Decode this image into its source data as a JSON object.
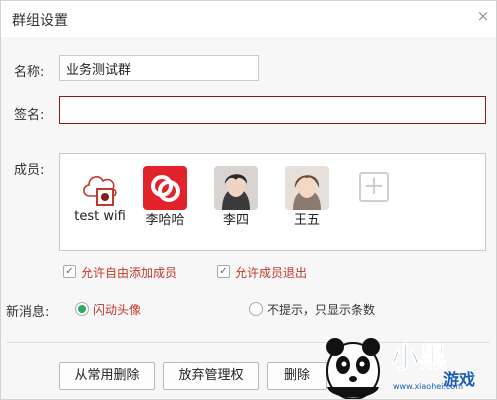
{
  "window": {
    "title": "群组设置",
    "close_label": "×"
  },
  "form": {
    "name_label": "名称:",
    "name_value": "业务测试群",
    "signature_label": "签名:",
    "signature_value": "",
    "members_label": "成员:",
    "new_message_label": "新消息:"
  },
  "members": [
    {
      "name": "test wifi",
      "avatar": "cloud-avatar-icon"
    },
    {
      "name": "李哈哈",
      "avatar": "red-chat-logo-icon"
    },
    {
      "name": "李四",
      "avatar": "photo-avatar"
    },
    {
      "name": "王五",
      "avatar": "photo-avatar"
    }
  ],
  "options": {
    "allow_add": {
      "label": "允许自由添加成员",
      "checked": true
    },
    "allow_exit": {
      "label": "允许成员退出",
      "checked": true
    },
    "msg_flash": {
      "label": "闪动头像",
      "selected": true
    },
    "msg_count": {
      "label": "不提示，只显示条数",
      "selected": false
    }
  },
  "buttons": {
    "remove_common": "从常用删除",
    "give_up_admin": "放弃管理权",
    "delete": "删除"
  },
  "watermark": {
    "text": "小黑游戏",
    "url": "www.xiaohei.com"
  },
  "colors": {
    "accent_red": "#c0392b",
    "radio_green": "#27ae60",
    "border_red": "#8b1a1a"
  }
}
